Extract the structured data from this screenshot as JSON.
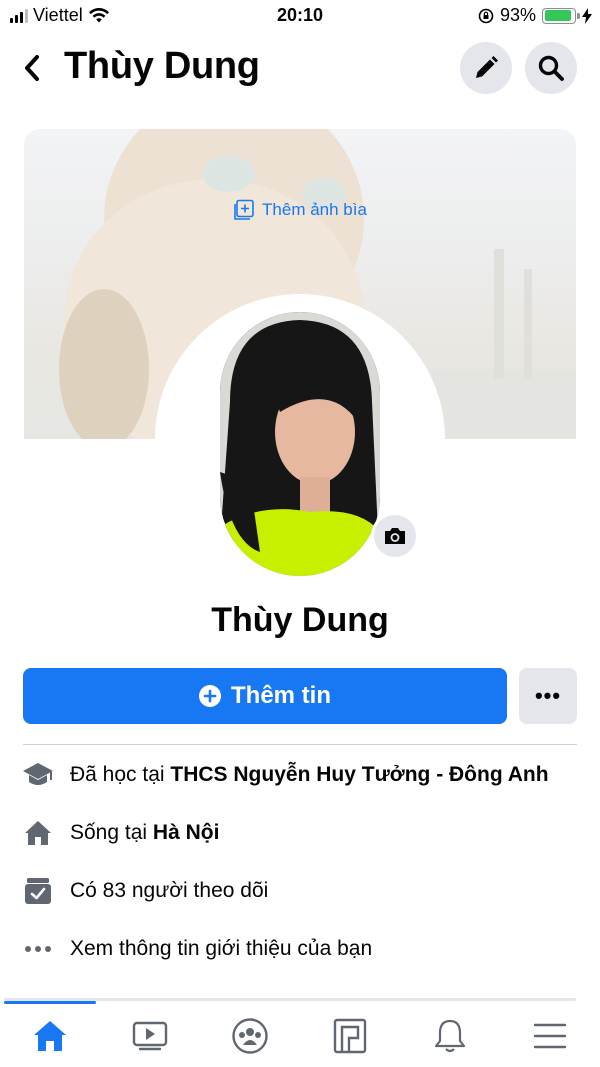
{
  "status_bar": {
    "carrier": "Viettel",
    "time": "20:10",
    "battery_percent": "93%",
    "battery_level": 0.93,
    "signal_bars_filled": 3,
    "signal_bars_total": 4
  },
  "header": {
    "title": "Thùy Dung",
    "icons": [
      "back-chevron-icon",
      "pencil-icon",
      "search-icon"
    ]
  },
  "cover": {
    "add_cover_label": "Thêm ảnh bìa"
  },
  "profile": {
    "name": "Thùy Dung"
  },
  "actions": {
    "add_story_label": "Thêm tin",
    "more_label": "•••"
  },
  "info": [
    {
      "icon": "graduation-cap-icon",
      "prefix": "Đã học tại ",
      "bold": "THCS Nguyễn Huy Tưởng - Đông Anh"
    },
    {
      "icon": "home-icon",
      "prefix": "Sống tại ",
      "bold": "Hà Nội"
    },
    {
      "icon": "followers-icon",
      "prefix": "Có 83 người theo dõi",
      "bold": ""
    },
    {
      "icon": "more-dots-icon",
      "prefix": "Xem thông tin giới thiệu của bạn",
      "bold": ""
    }
  ],
  "bottom_nav": {
    "items": [
      "home-icon",
      "watch-icon",
      "groups-icon",
      "pages-icon",
      "notifications-icon",
      "menu-icon"
    ],
    "active": "home-icon"
  },
  "colors": {
    "accent": "#1877f2",
    "button_gray": "#e4e6eb",
    "text": "#050505",
    "icon_gray": "#606770"
  }
}
